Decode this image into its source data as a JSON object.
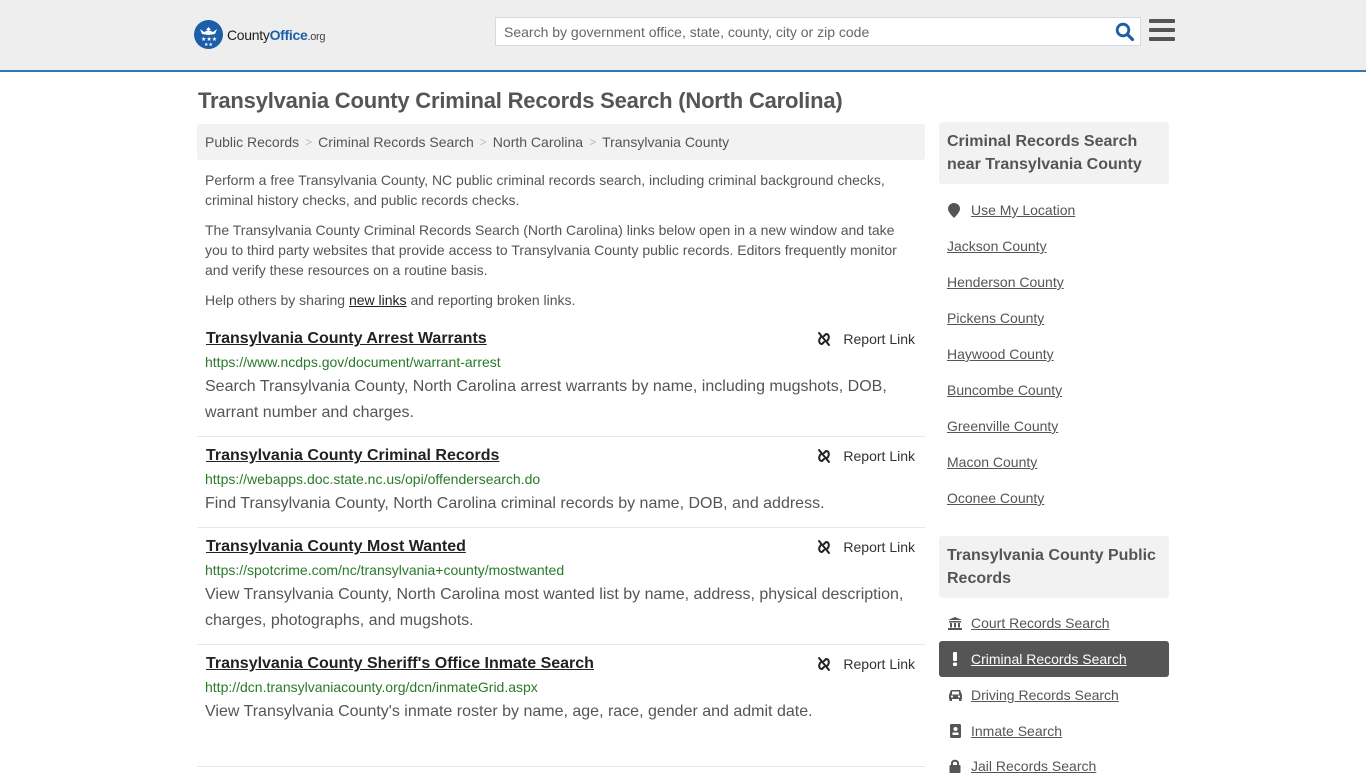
{
  "header": {
    "logo": {
      "county": "County",
      "office": "Office",
      "org": ".org"
    },
    "search_placeholder": "Search by government office, state, county, city or zip code",
    "search_value": "",
    "icons": {
      "search": "search-icon",
      "menu": "hamburger-menu-icon",
      "logo": "eagle-stars-badge"
    }
  },
  "page": {
    "title": "Transylvania County Criminal Records Search (North Carolina)"
  },
  "breadcrumb": [
    {
      "label": "Public Records"
    },
    {
      "label": "Criminal Records Search"
    },
    {
      "label": "North Carolina"
    },
    {
      "label": "Transylvania County"
    }
  ],
  "intro": {
    "p1": "Perform a free Transylvania County, NC public criminal records search, including criminal background checks, criminal history checks, and public records checks.",
    "p2": "The Transylvania County Criminal Records Search (North Carolina) links below open in a new window and take you to third party websites that provide access to Transylvania County public records. Editors frequently monitor and verify these resources on a routine basis.",
    "p3_before": "Help others by sharing ",
    "p3_link": "new links",
    "p3_after": " and reporting broken links."
  },
  "results": [
    {
      "title": "Transylvania County Arrest Warrants",
      "url": "https://www.ncdps.gov/document/warrant-arrest",
      "description": "Search Transylvania County, North Carolina arrest warrants by name, including mugshots, DOB, warrant number and charges.",
      "report_label": "Report Link"
    },
    {
      "title": "Transylvania County Criminal Records",
      "url": "https://webapps.doc.state.nc.us/opi/offendersearch.do",
      "description": "Find Transylvania County, North Carolina criminal records by name, DOB, and address.",
      "report_label": "Report Link"
    },
    {
      "title": "Transylvania County Most Wanted",
      "url": "https://spotcrime.com/nc/transylvania+county/mostwanted",
      "description": "View Transylvania County, North Carolina most wanted list by name, address, physical description, charges, photographs, and mugshots.",
      "report_label": "Report Link"
    },
    {
      "title": "Transylvania County Sheriff's Office Inmate Search",
      "url": "http://dcn.transylvaniacounty.org/dcn/inmateGrid.aspx",
      "description": "View Transylvania County's inmate roster by name, age, race, gender and admit date.",
      "report_label": "Report Link"
    }
  ],
  "sidebar": {
    "nearby": {
      "heading": "Criminal Records Search near Transylvania County",
      "use_location": "Use My Location",
      "counties": [
        "Jackson County",
        "Henderson County",
        "Pickens County",
        "Haywood County",
        "Buncombe County",
        "Greenville County",
        "Macon County",
        "Oconee County"
      ]
    },
    "public_records": {
      "heading": "Transylvania County Public Records",
      "items": [
        {
          "label": "Court Records Search",
          "icon": "courthouse-icon",
          "active": false
        },
        {
          "label": "Criminal Records Search",
          "icon": "exclamation-icon",
          "active": true
        },
        {
          "label": "Driving Records Search",
          "icon": "car-icon",
          "active": false
        },
        {
          "label": "Inmate Search",
          "icon": "id-badge-icon",
          "active": false
        },
        {
          "label": "Jail Records Search",
          "icon": "lock-icon",
          "active": false
        }
      ]
    }
  },
  "colors": {
    "brand_blue": "#1b5fa8",
    "header_bg": "#eeeeee",
    "header_rule": "#3277b5",
    "url_green": "#2a7a2a",
    "active_item_bg": "#555555"
  }
}
